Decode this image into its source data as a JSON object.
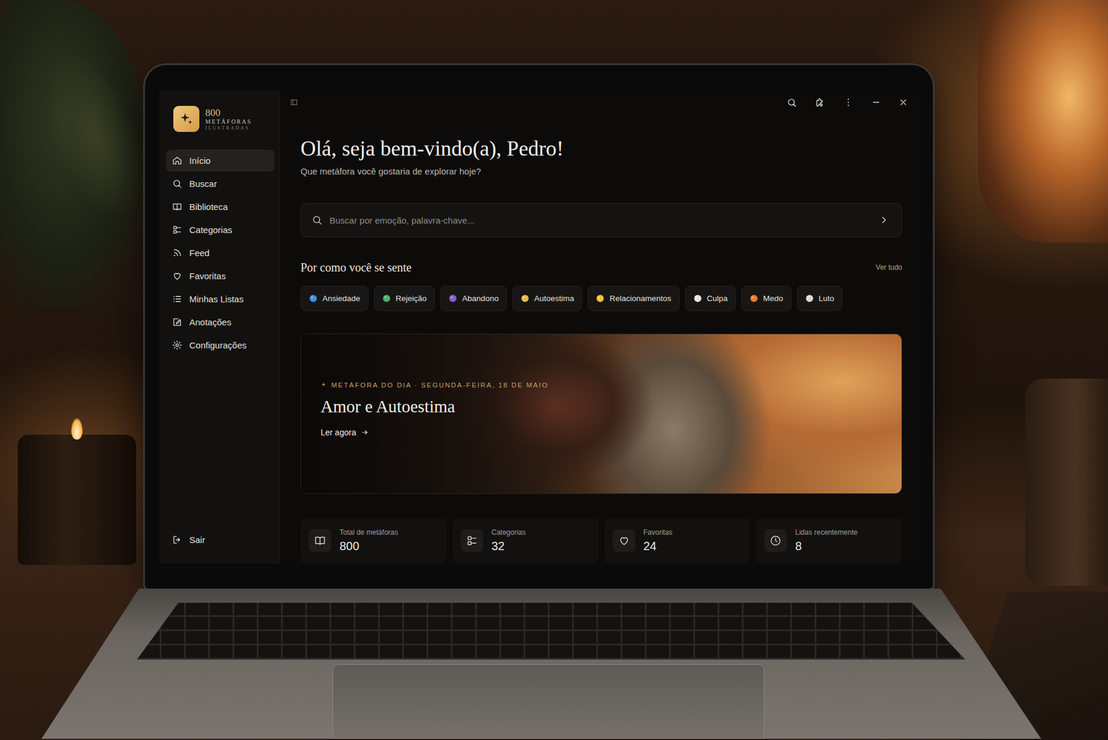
{
  "app": {
    "logo": {
      "number": "800",
      "line1": "METÁFORAS",
      "line2": "ILUSTRADAS"
    }
  },
  "sidebar": {
    "items": [
      {
        "label": "Início",
        "selected": true
      },
      {
        "label": "Buscar",
        "selected": false
      },
      {
        "label": "Biblioteca",
        "selected": false
      },
      {
        "label": "Categorias",
        "selected": false
      },
      {
        "label": "Feed",
        "selected": false
      },
      {
        "label": "Favoritas",
        "selected": false
      },
      {
        "label": "Minhas Listas",
        "selected": false
      },
      {
        "label": "Anotações",
        "selected": false
      },
      {
        "label": "Configurações",
        "selected": false
      }
    ],
    "logout": "Sair"
  },
  "greeting": {
    "title": "Olá, seja bem-vindo(a), Pedro!",
    "subtitle": "Que metáfora você gostaria de explorar hoje?"
  },
  "search": {
    "placeholder": "Buscar por emoção, palavra-chave..."
  },
  "feelings": {
    "title": "Por como você se sente",
    "see_all": "Ver tudo",
    "chips": [
      {
        "label": "Ansiedade",
        "color": "#3f8fe0"
      },
      {
        "label": "Rejeição",
        "color": "#4caf6a"
      },
      {
        "label": "Abandono",
        "color": "#8a5ad6"
      },
      {
        "label": "Autoestima",
        "color": "#e8b84a"
      },
      {
        "label": "Relacionamentos",
        "color": "#f2c230"
      },
      {
        "label": "Culpa",
        "color": "#e8e4de"
      },
      {
        "label": "Medo",
        "color": "#f07a2a"
      },
      {
        "label": "Luto",
        "color": "#d8d6d2"
      }
    ]
  },
  "featured": {
    "eyebrow": "METÁFORA DO DIA · SEGUNDA-FEIRA, 18 DE MAIO",
    "title": "Amor e Autoestima",
    "action": "Ler agora"
  },
  "stats": [
    {
      "label": "Total de metáforas",
      "value": "800"
    },
    {
      "label": "Categorias",
      "value": "32"
    },
    {
      "label": "Favoritas",
      "value": "24"
    },
    {
      "label": "Lidas recentemente",
      "value": "8"
    }
  ]
}
